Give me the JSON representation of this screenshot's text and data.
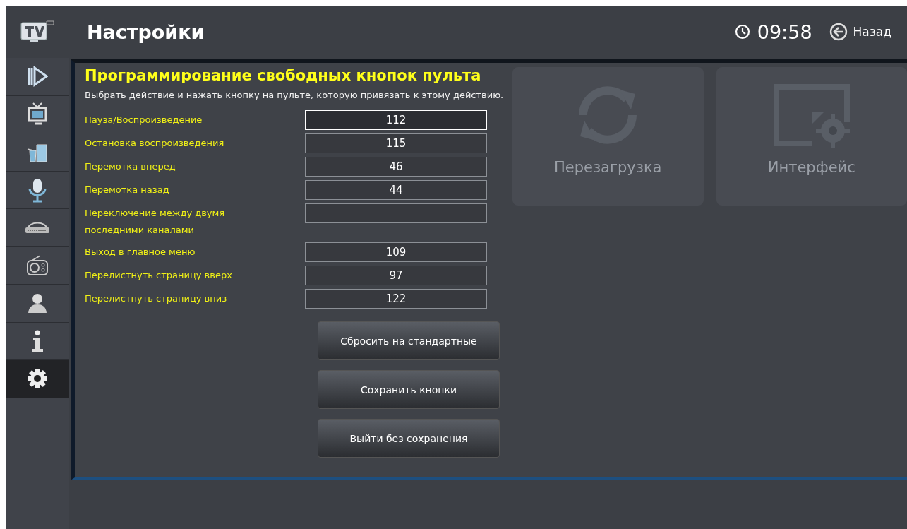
{
  "header": {
    "title": "Настройки",
    "time": "09:58",
    "back": "Назад"
  },
  "sidebar": {
    "items": [
      {
        "kind": "play",
        "selected": false
      },
      {
        "kind": "tv",
        "selected": false
      },
      {
        "kind": "drinks",
        "selected": false
      },
      {
        "kind": "mic",
        "selected": false
      },
      {
        "kind": "club",
        "selected": false
      },
      {
        "kind": "radio",
        "selected": false
      },
      {
        "kind": "person",
        "selected": false
      },
      {
        "kind": "info",
        "selected": false
      },
      {
        "kind": "gear",
        "selected": true
      }
    ]
  },
  "background_tiles": [
    {
      "kind": "reload",
      "label": "Перезагрузка"
    },
    {
      "kind": "interface",
      "label": "Интерфейс"
    }
  ],
  "dialog": {
    "title": "Программирование свободных кнопок пульта",
    "hint": "Выбрать действие и нажать кнопку на пульте, которую привязать к этому действию.",
    "rows": [
      {
        "label": "Пауза/Воспроизведение",
        "value": "112",
        "selected": true
      },
      {
        "label": "Остановка воспроизведения",
        "value": "115",
        "selected": false
      },
      {
        "label": "Перемотка вперед",
        "value": "46",
        "selected": false
      },
      {
        "label": "Перемотка назад",
        "value": "44",
        "selected": false
      },
      {
        "label": "Переключение между двумя последними каналами",
        "value": "",
        "selected": false
      },
      {
        "label": "Выход в главное меню",
        "value": "109",
        "selected": false
      },
      {
        "label": "Перелистнуть страницу вверх",
        "value": "97",
        "selected": false
      },
      {
        "label": "Перелистнуть страницу вниз",
        "value": "122",
        "selected": false
      }
    ],
    "buttons": [
      "Сбросить на стандартные",
      "Сохранить кнопки",
      "Выйти без сохранения"
    ]
  }
}
